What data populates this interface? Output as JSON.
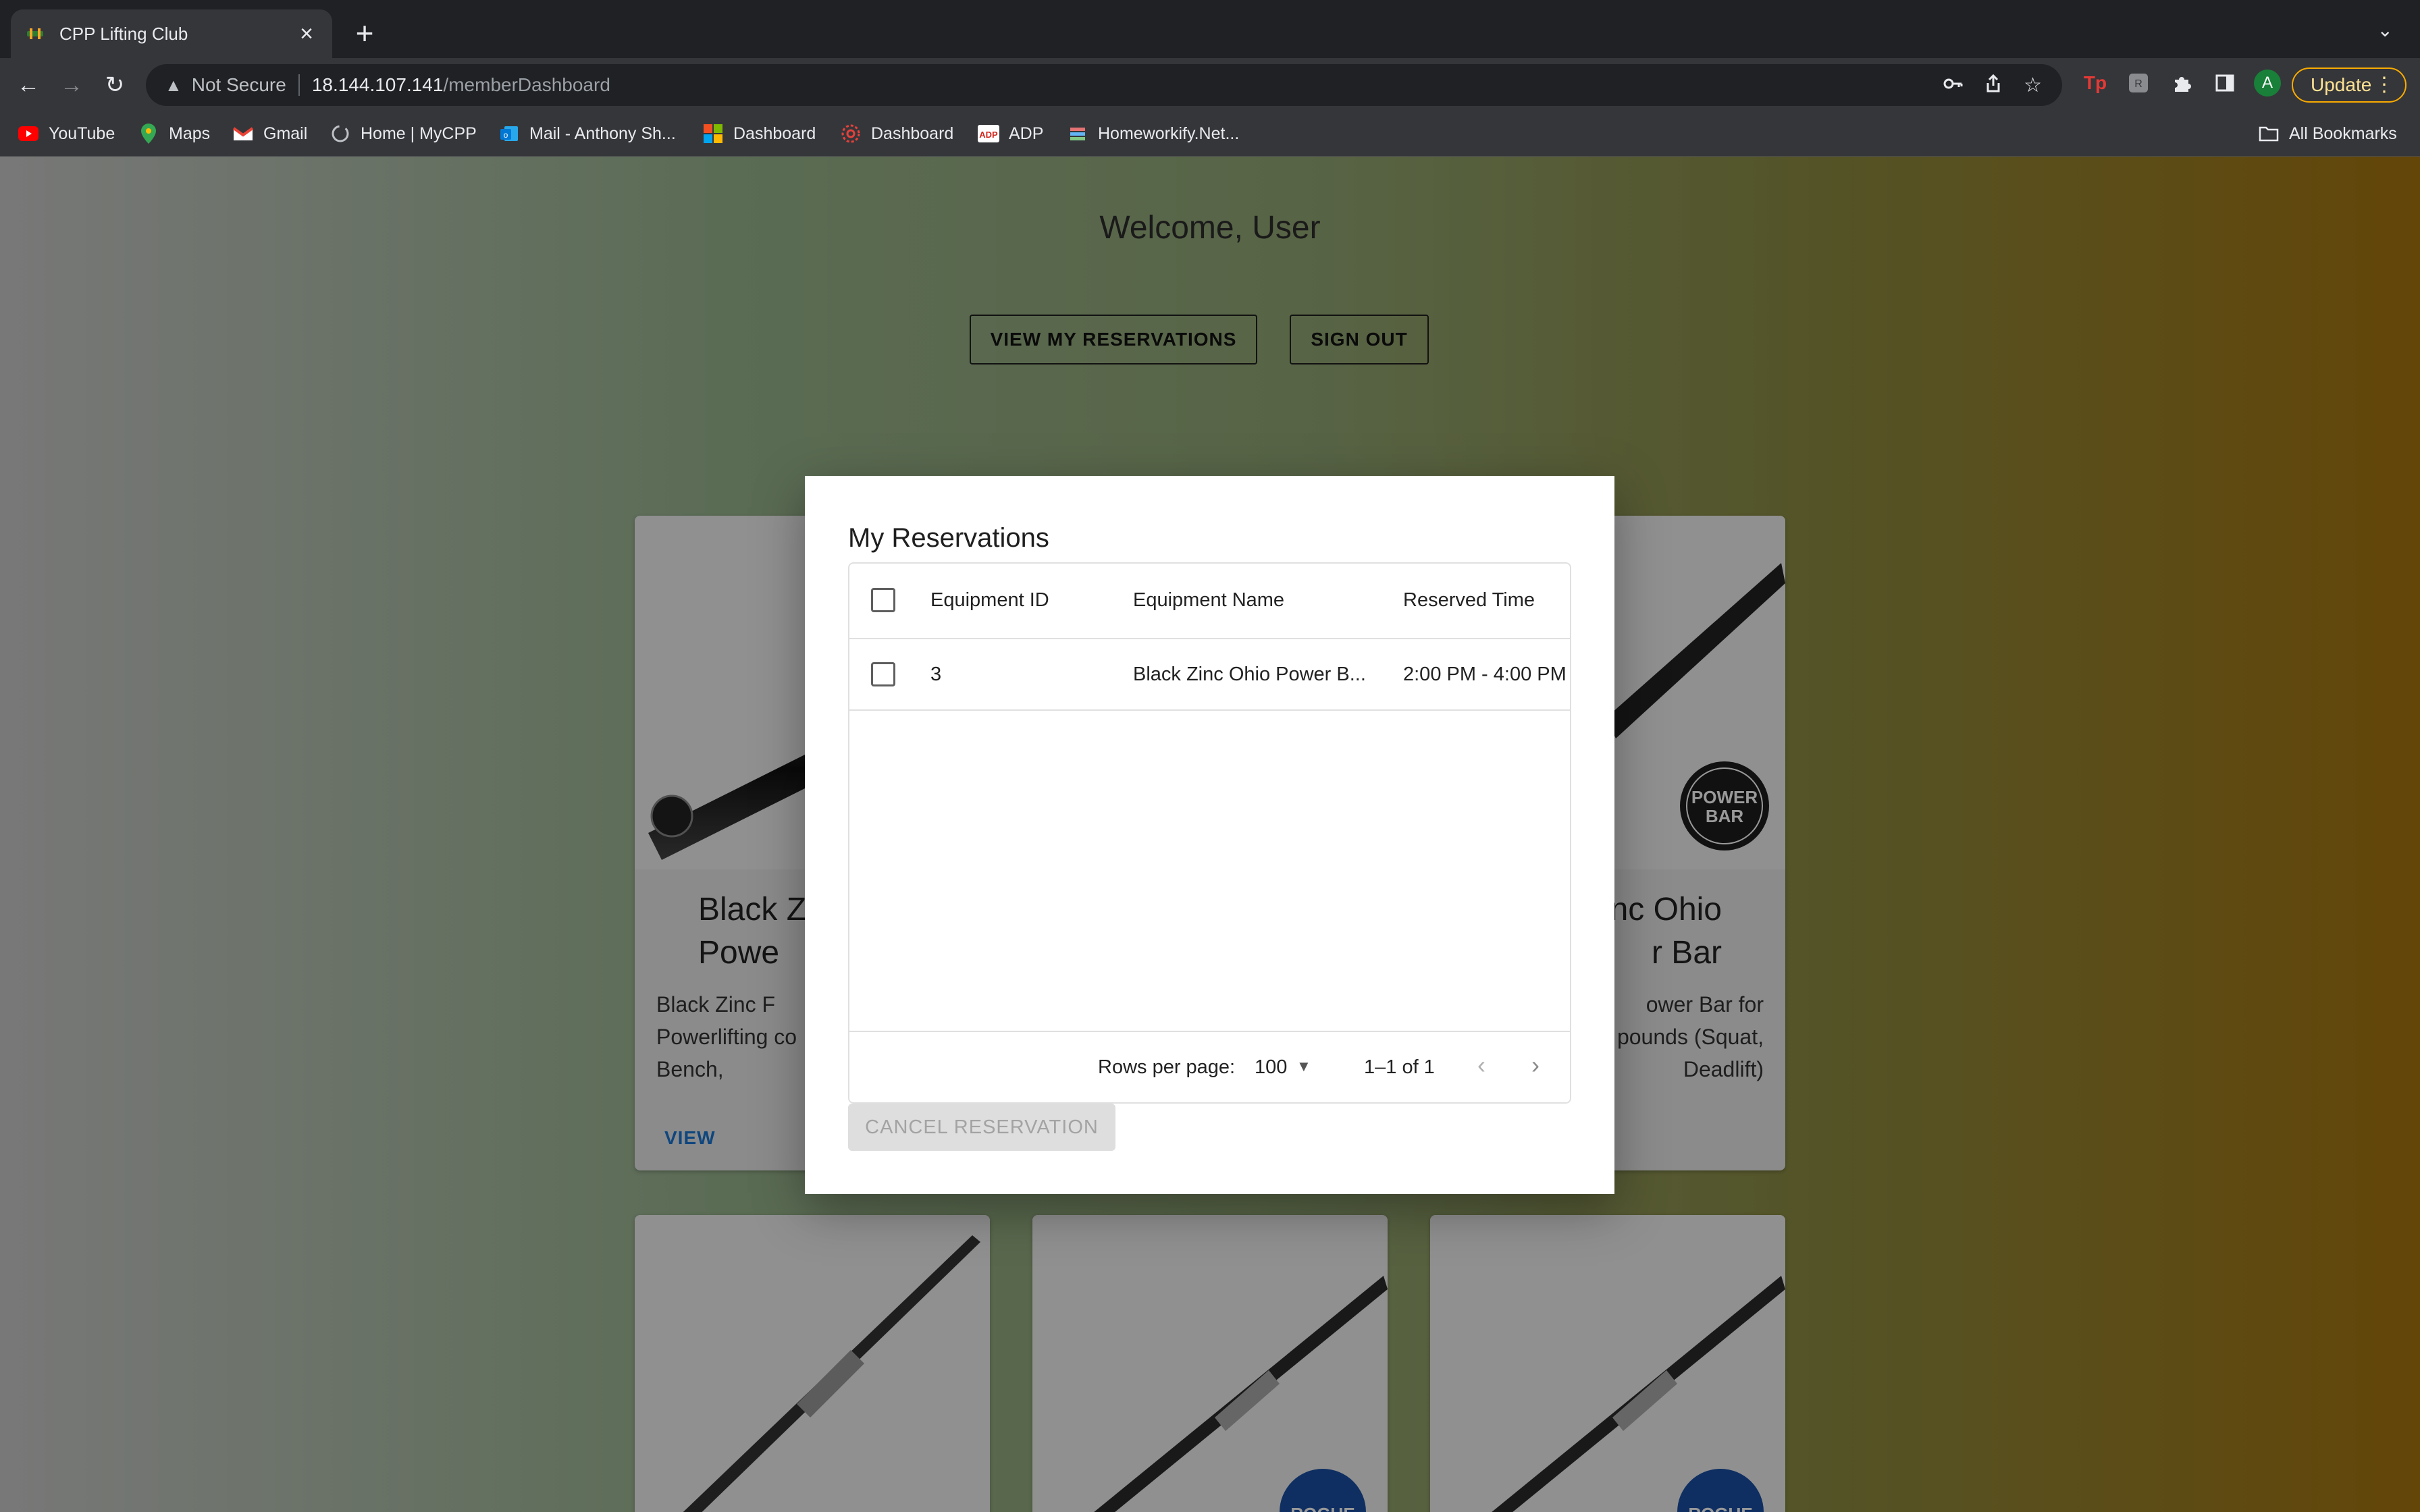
{
  "browser": {
    "tab": {
      "title": "CPP Lifting Club",
      "close": "×"
    },
    "new_tab": "+",
    "tab_list": "⌄",
    "nav": {
      "back": "←",
      "forward": "→",
      "reload": "↻"
    },
    "address": {
      "security": "Not Secure",
      "host": "18.144.107.141",
      "path": "/memberDashboard"
    },
    "update_label": "Update",
    "profile_initial": "A",
    "bookmarks": [
      {
        "label": "YouTube",
        "icon": "youtube-icon"
      },
      {
        "label": "Maps",
        "icon": "maps-icon"
      },
      {
        "label": "Gmail",
        "icon": "gmail-icon"
      },
      {
        "label": "Home | MyCPP",
        "icon": "mycpp-icon"
      },
      {
        "label": "Mail - Anthony Sh...",
        "icon": "outlook-icon"
      },
      {
        "label": "Dashboard",
        "icon": "microsoft-icon"
      },
      {
        "label": "Dashboard",
        "icon": "canvas-icon"
      },
      {
        "label": "ADP",
        "icon": "adp-icon"
      },
      {
        "label": "Homeworkify.Net...",
        "icon": "homeworkify-icon"
      }
    ],
    "all_bookmarks": "All Bookmarks"
  },
  "page": {
    "welcome": "Welcome, User",
    "view_reservations_button": "VIEW MY RESERVATIONS",
    "sign_out_button": "SIGN OUT",
    "cards": [
      {
        "title_visible": "Black Z\nPowe",
        "desc_visible": "Black Zinc F\nPowerlifting co\nBench,",
        "view": "VIEW"
      },
      {
        "title_visible": "nc Ohio\nr Bar",
        "desc_visible": "ower Bar for\npounds (Squat,\nDeadlift)"
      }
    ],
    "badges": {
      "power_bar": "POWER BAR",
      "rogue": "ROGUE"
    }
  },
  "dialog": {
    "title": "My Reservations",
    "columns": [
      "Equipment ID",
      "Equipment Name",
      "Reserved Time"
    ],
    "rows": [
      {
        "id": "3",
        "name": "Black Zinc Ohio Power B...",
        "time": "2:00 PM - 4:00 PM"
      }
    ],
    "footer": {
      "rows_per_page_label": "Rows per page:",
      "rows_per_page_value": "100",
      "range": "1–1 of 1"
    },
    "cancel_button": "CANCEL RESERVATION"
  },
  "colors": {
    "accent_link": "#1976d2",
    "update_border": "#f9ab00",
    "chrome_dark": "#202124",
    "chrome_toolbar": "#35363a"
  }
}
